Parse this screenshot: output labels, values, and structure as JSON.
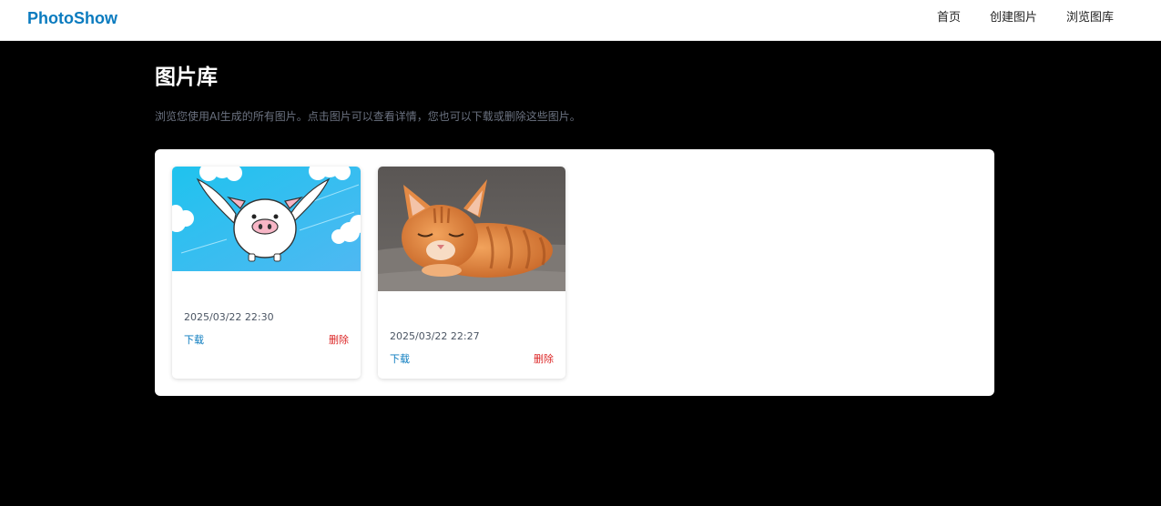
{
  "header": {
    "brand": "PhotoShow",
    "nav": [
      {
        "label": "首页"
      },
      {
        "label": "创建图片"
      },
      {
        "label": "浏览图库"
      }
    ]
  },
  "page": {
    "title": "图片库",
    "description": "浏览您使用AI生成的所有图片。点击图片可以查看详情，您也可以下载或删除这些图片。"
  },
  "gallery": {
    "cards": [
      {
        "image_subject": "flying pig cartoon",
        "date": "2025/03/22 22:30",
        "download_label": "下载",
        "delete_label": "删除"
      },
      {
        "image_subject": "sleeping orange tabby cat",
        "date": "2025/03/22 22:27",
        "download_label": "下载",
        "delete_label": "删除"
      }
    ]
  },
  "colors": {
    "brand": "#0a7bbf",
    "delete": "#dc2626",
    "background": "#000000",
    "panel": "#ffffff"
  }
}
